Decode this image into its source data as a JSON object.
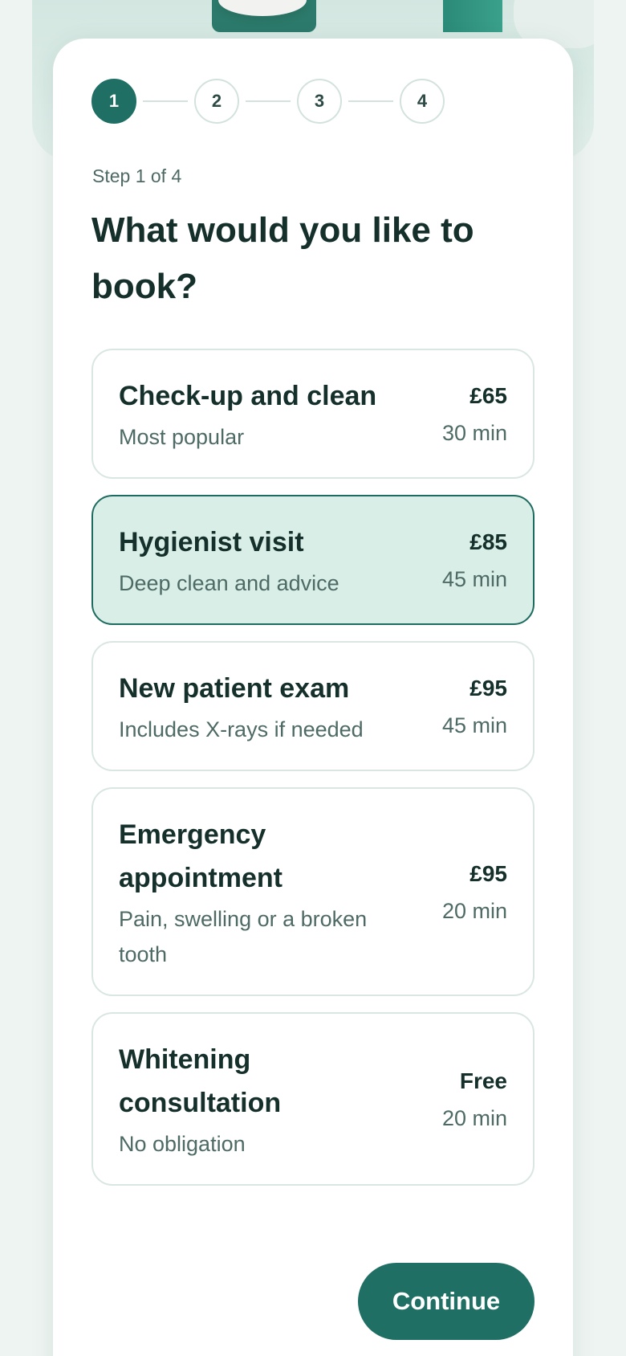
{
  "stepper": {
    "steps": [
      "1",
      "2",
      "3",
      "4"
    ],
    "active": 1
  },
  "step_label": "Step 1 of 4",
  "question": "What would you like to book?",
  "options": [
    {
      "title": "Check-up and clean",
      "desc": "Most popular",
      "price": "£65",
      "duration": "30 min"
    },
    {
      "title": "Hygienist visit",
      "desc": "Deep clean and advice",
      "price": "£85",
      "duration": "45 min",
      "selected": true
    },
    {
      "title": "New patient exam",
      "desc": "Includes X-rays if needed",
      "price": "£95",
      "duration": "45 min"
    },
    {
      "title": "Emergency appointment",
      "desc": "Pain, swelling or a broken tooth",
      "price": "£95",
      "duration": "20 min"
    },
    {
      "title": "Whitening consultation",
      "desc": "No obligation",
      "price": "Free",
      "duration": "20 min"
    }
  ],
  "continue_label": "Continue",
  "colors": {
    "accent": "#1f6f65",
    "selected_bg": "#d8eee7",
    "text": "#15302b"
  }
}
